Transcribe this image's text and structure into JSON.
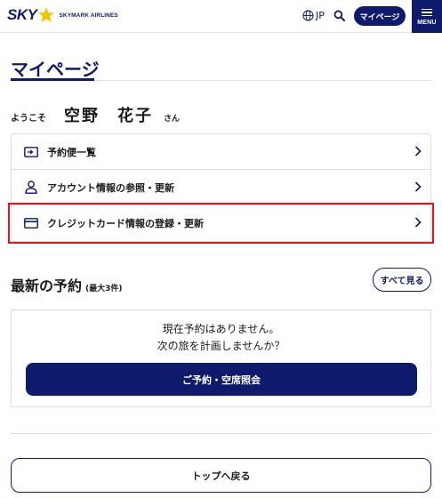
{
  "header": {
    "logo_sky": "SKY",
    "logo_text": "SKYMARK AIRLINES",
    "lang": "JP",
    "mypage_button": "マイページ",
    "menu_label": "MENU"
  },
  "page": {
    "title": "マイページ",
    "welcome_pre": "ようこそ",
    "user_name": "空野　花子",
    "welcome_post": "さん"
  },
  "menu": {
    "items": [
      {
        "label": "予約便一覧",
        "icon": "ticket-icon"
      },
      {
        "label": "アカウント情報の参照・更新",
        "icon": "person-icon"
      },
      {
        "label": "クレジットカード情報の登録・更新",
        "icon": "credit-card-icon"
      }
    ]
  },
  "reservations": {
    "title": "最新の予約",
    "subtitle": "(最大3件)",
    "see_all": "すべて見る",
    "empty_line1": "現在予約はありません。",
    "empty_line2": "次の旅を計画しませんか？",
    "book_button": "ご予約・空席照会"
  },
  "footer": {
    "top_button": "トップへ戻る"
  },
  "colors": {
    "brand_navy": "#0e1a6b",
    "highlight_red": "#e0151f",
    "star_yellow": "#f5c400"
  }
}
